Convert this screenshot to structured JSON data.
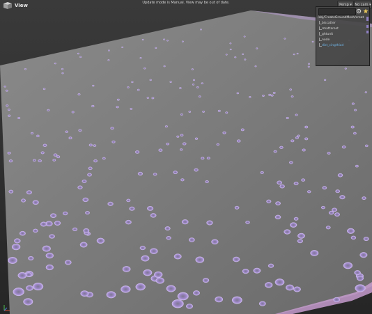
{
  "app": {
    "view_label": "View",
    "status_message": "Update mode is Manual. View may be out of date."
  },
  "toolbar": {
    "persp_label": "Persp ▾",
    "cam_label": "No cam ▾"
  },
  "tree_panel": {
    "root": "/obj/CreateGroundMesh/creat",
    "items": [
      {
        "label": "biscatter",
        "highlight": false
      },
      {
        "label": "rmattarset",
        "highlight": false
      },
      {
        "label": "ghtunit",
        "highlight": false
      },
      {
        "label": "node",
        "highlight": false
      },
      {
        "label": "dist_cingthiad",
        "highlight": true
      }
    ]
  },
  "colors": {
    "terrain": "#777777",
    "crater": "#a98bd1",
    "accent": "#6fb5e8"
  },
  "icons": [
    "view-icon",
    "gear-icon",
    "star-icon",
    "axis-gizmo-icon"
  ]
}
